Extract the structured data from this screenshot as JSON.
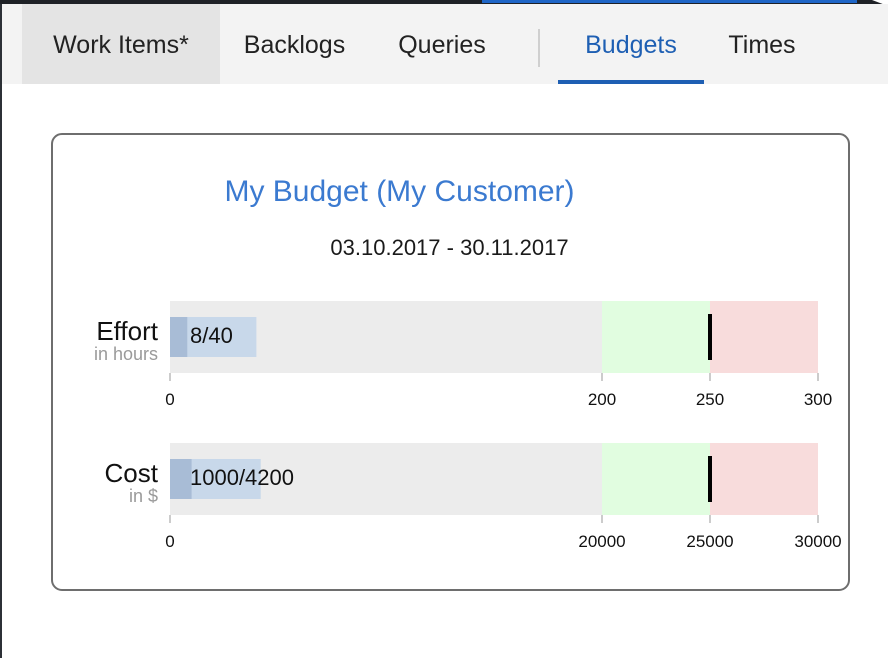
{
  "tabs": [
    {
      "label": "Work Items*"
    },
    {
      "label": "Backlogs"
    },
    {
      "label": "Queries"
    },
    {
      "label": "Budgets"
    },
    {
      "label": "Times"
    }
  ],
  "budget": {
    "title": "My Budget (My Customer)",
    "dates": "03.10.2017 - 30.11.2017"
  },
  "chart_data": [
    {
      "type": "bullet",
      "title": "Effort",
      "subtitle": "in hours",
      "range_max": 300,
      "ranges": [
        200,
        250,
        300
      ],
      "range_colors": [
        "#ececec",
        "#e1fde0",
        "#f8dcdc"
      ],
      "measures": [
        40,
        8
      ],
      "measure_colors": [
        "#c8d8ea",
        "#a8bcd6"
      ],
      "marker": 250,
      "label": "8/40",
      "ticks": [
        "0",
        "200",
        "250",
        "300"
      ],
      "tick_values": [
        0,
        200,
        250,
        300
      ]
    },
    {
      "type": "bullet",
      "title": "Cost",
      "subtitle": "in $",
      "range_max": 30000,
      "ranges": [
        20000,
        25000,
        30000
      ],
      "range_colors": [
        "#ececec",
        "#e1fde0",
        "#f8dcdc"
      ],
      "measures": [
        4200,
        1000
      ],
      "measure_colors": [
        "#c8d8ea",
        "#a8bcd6"
      ],
      "marker": 25000,
      "label": "1000/4200",
      "ticks": [
        "0",
        "20000",
        "25000",
        "30000"
      ],
      "tick_values": [
        0,
        20000,
        25000,
        30000
      ]
    }
  ]
}
